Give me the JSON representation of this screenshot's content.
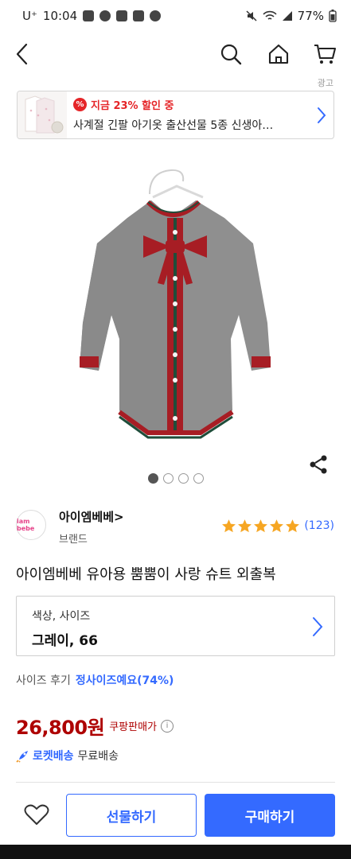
{
  "status_bar": {
    "carrier": "U⁺",
    "time": "10:04",
    "battery": "77%"
  },
  "ad": {
    "label": "광고",
    "discount": "지금 23% 할인 중",
    "discount_icon_text": "%",
    "title": "사계절 긴팔 아기옷 출산선물 5종 신생아…"
  },
  "gallery": {
    "dot_count": 4,
    "active_index": 0
  },
  "brand": {
    "logo_text": "iam bebe",
    "name": "아이엠베베",
    "sub": "브랜드",
    "rating": 5,
    "review_count": "(123)"
  },
  "product": {
    "title": "아이엠베베 유아용 뿜뿜이 사랑 슈트 외출복"
  },
  "option": {
    "label": "색상, 사이즈",
    "value": "그레이, 66"
  },
  "size_review": {
    "label": "사이즈 후기",
    "value": "정사이즈예요(74%)"
  },
  "price": {
    "amount": "26,800원",
    "label": "쿠팡판매가",
    "info_icon": "i"
  },
  "shipping": {
    "rocket": "로켓배송",
    "free": "무료배송"
  },
  "actions": {
    "gift": "선물하기",
    "buy": "구매하기"
  },
  "colors": {
    "accent": "#346aff",
    "price": "#ae0000",
    "discount": "#e52528"
  }
}
